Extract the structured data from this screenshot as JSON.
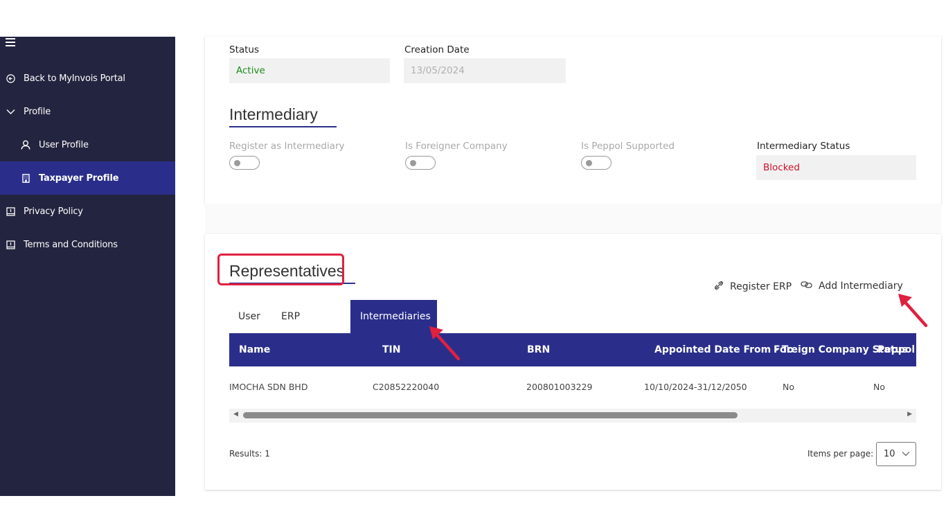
{
  "sidebar": {
    "items": [
      {
        "label": "Back to MyInvois Portal",
        "icon": "back-circle-icon"
      },
      {
        "label": "Profile",
        "icon": "chevron-down-icon"
      },
      {
        "label": "User Profile",
        "icon": "user-icon"
      },
      {
        "label": "Taxpayer Profile",
        "icon": "building-icon"
      },
      {
        "label": "Privacy Policy",
        "icon": "book-icon"
      },
      {
        "label": "Terms and Conditions",
        "icon": "book-icon"
      }
    ]
  },
  "status_section": {
    "status_label": "Status",
    "status_value": "Active",
    "creation_date_label": "Creation Date",
    "creation_date_value": "13/05/2024"
  },
  "intermediary": {
    "title": "Intermediary",
    "register_label": "Register as Intermediary",
    "foreigner_label": "Is Foreigner Company",
    "peppol_label": "Is Peppol Supported",
    "status_label": "Intermediary Status",
    "status_value": "Blocked"
  },
  "representatives": {
    "title": "Representatives",
    "register_erp": "Register ERP",
    "add_intermediary": "Add Intermediary",
    "tabs": [
      "User",
      "ERP",
      "Intermediaries"
    ],
    "columns": [
      "Name",
      "TIN",
      "BRN",
      "Appointed Date From - To",
      "Foreign Company Status",
      "Peppol S"
    ],
    "rows": [
      {
        "name": "IMOCHA SDN BHD",
        "tin": "C20852220040",
        "brn": "200801003229",
        "appointed": "10/10/2024-31/12/2050",
        "foreign": "No",
        "peppol": "No"
      }
    ],
    "results": "Results: 1",
    "items_per_page_label": "Items per page:",
    "items_per_page_value": "10"
  },
  "colors": {
    "sidebar_bg": "#23243f",
    "accent": "#2a2e8a",
    "active_text": "#1a8a1a",
    "blocked_text": "#c8102e",
    "highlight": "#e0203f"
  }
}
